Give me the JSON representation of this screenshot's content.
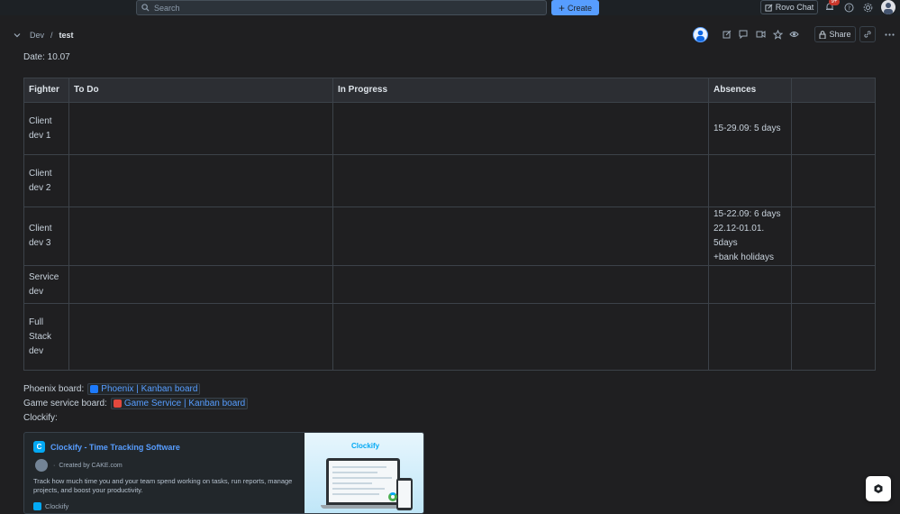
{
  "topbar": {
    "search_placeholder": "Search",
    "create_label": "Create",
    "rovo_label": "Rovo Chat",
    "notif_count": "9+"
  },
  "breadcrumb": {
    "parent": "Dev",
    "separator": "/",
    "current": "test"
  },
  "page_actions": {
    "share_label": "Share"
  },
  "page": {
    "date_text": "Date: 10.07",
    "table": {
      "headers": [
        "Fighter",
        "To Do",
        "In Progress",
        "Absences",
        ""
      ],
      "rows": [
        {
          "fighter": "Client dev 1",
          "todo": "",
          "in_progress": "",
          "absences": [
            "15-29.09: 5 days"
          ],
          "extra": ""
        },
        {
          "fighter": "Client dev 2",
          "todo": "",
          "in_progress": "",
          "absences": [],
          "extra": ""
        },
        {
          "fighter": "Client dev 3",
          "todo": "",
          "in_progress": "",
          "absences": [
            "15-22.09: 6 days",
            "22.12-01.01. 5days",
            "+bank holidays"
          ],
          "extra": ""
        },
        {
          "fighter": "Service dev",
          "todo": "",
          "in_progress": "",
          "absences": [],
          "extra": ""
        },
        {
          "fighter": "Full Stack dev",
          "todo": "",
          "in_progress": "",
          "absences": [],
          "extra": ""
        }
      ]
    },
    "phoenix_label": "Phoenix board:",
    "phoenix_link": "Phoenix | Kanban board",
    "game_label": "Game service board:",
    "game_link": "Game Service | Kanban board",
    "clockify_label": "Clockify:",
    "card": {
      "title": "Clockify - Time Tracking Software",
      "created_by": "Created by CAKE.com",
      "description": "Track how much time you and your team spend working on tasks, run reports, manage projects, and boost your productivity.",
      "source": "Clockify",
      "brand": "Clockify"
    }
  },
  "colors": {
    "accent": "#579dff",
    "background": "#1f1f21",
    "table_header": "#2c2e33",
    "link": "#579dff"
  }
}
